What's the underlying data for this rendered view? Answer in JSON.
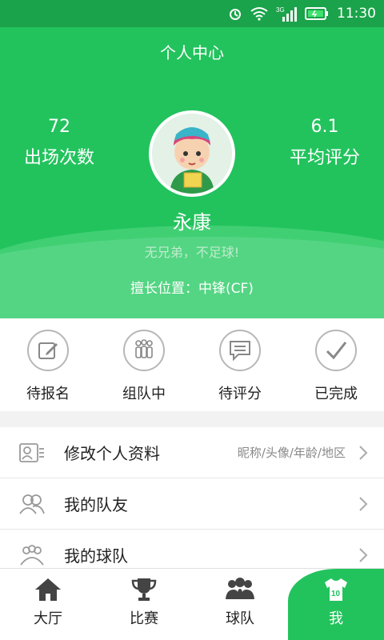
{
  "status_bar": {
    "time": "11:30",
    "network": "3G"
  },
  "header": {
    "title": "个人中心",
    "appearances": {
      "value": "72",
      "label": "出场次数"
    },
    "rating": {
      "value": "6.1",
      "label": "平均评分"
    },
    "name": "永康",
    "motto": "无兄弟，不足球!",
    "position_label": "擅长位置：中锋(CF)"
  },
  "status_row": [
    {
      "label": "待报名",
      "icon": "edit-icon"
    },
    {
      "label": "组队中",
      "icon": "team-icon"
    },
    {
      "label": "待评分",
      "icon": "comment-icon"
    },
    {
      "label": "已完成",
      "icon": "check-icon"
    }
  ],
  "list": [
    {
      "title": "修改个人资料",
      "hint": "昵称/头像/年龄/地区",
      "icon": "profile-card-icon"
    },
    {
      "title": "我的队友",
      "hint": "",
      "icon": "teammates-icon"
    },
    {
      "title": "我的球队",
      "hint": "",
      "icon": "team-group-icon"
    }
  ],
  "tabs": [
    {
      "label": "大厅",
      "icon": "home-icon"
    },
    {
      "label": "比赛",
      "icon": "trophy-icon"
    },
    {
      "label": "球队",
      "icon": "team-icon"
    },
    {
      "label": "我",
      "icon": "jersey-icon",
      "jersey_number": "10",
      "active": true
    }
  ],
  "colors": {
    "primary": "#22c35d",
    "statusbar": "#1aa34a"
  }
}
